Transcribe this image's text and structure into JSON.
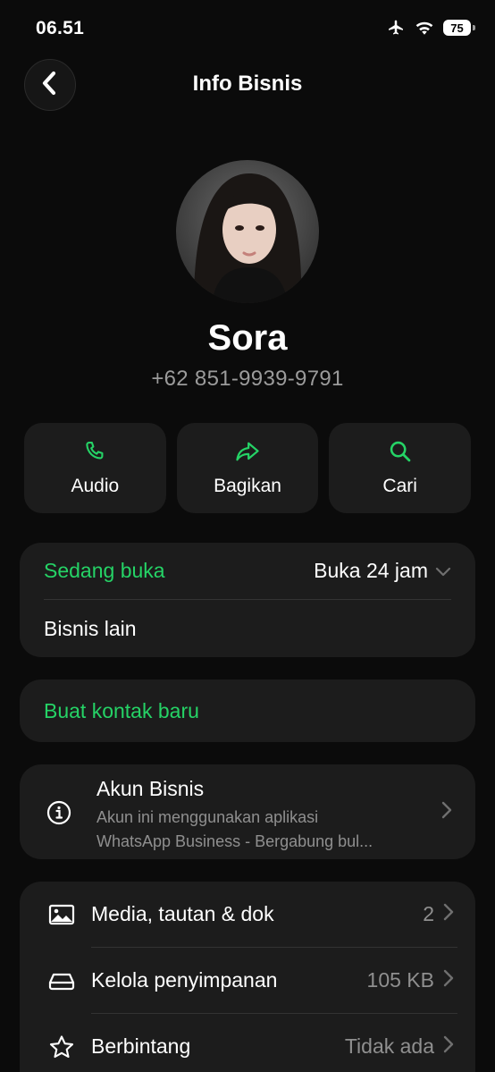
{
  "status_bar": {
    "time": "06.51",
    "battery": "75",
    "icons": [
      "airplane-icon",
      "wifi-icon",
      "battery-icon"
    ]
  },
  "header": {
    "title": "Info Bisnis",
    "back_icon": "chevron-left-icon"
  },
  "profile": {
    "name": "Sora",
    "phone": "+62 851-9939-9791"
  },
  "actions": [
    {
      "label": "Audio",
      "icon": "phone-icon"
    },
    {
      "label": "Bagikan",
      "icon": "share-icon"
    },
    {
      "label": "Cari",
      "icon": "search-icon"
    }
  ],
  "hours": {
    "status": "Sedang buka",
    "value": "Buka 24 jam",
    "other": "Bisnis lain"
  },
  "new_contact": {
    "label": "Buat kontak baru"
  },
  "business_account": {
    "title": "Akun Bisnis",
    "desc_line1": "Akun ini menggunakan aplikasi",
    "desc_line2": "WhatsApp Business - Bergabung bul..."
  },
  "list": [
    {
      "label": "Media, tautan & dok",
      "value": "2",
      "icon": "image-icon"
    },
    {
      "label": "Kelola penyimpanan",
      "value": "105 KB",
      "icon": "storage-icon"
    },
    {
      "label": "Berbintang",
      "value": "Tidak ada",
      "icon": "star-icon"
    }
  ],
  "colors": {
    "accent": "#25d366",
    "background": "#0b0b0b",
    "card": "#1c1c1c",
    "secondary_text": "#8f8f8f"
  }
}
